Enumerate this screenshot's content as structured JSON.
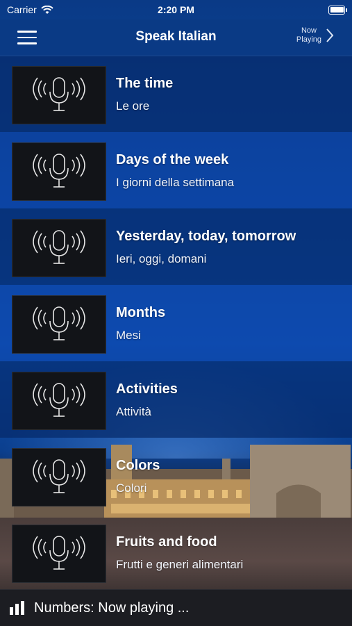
{
  "status_bar": {
    "carrier": "Carrier",
    "time": "2:20 PM"
  },
  "nav": {
    "title": "Speak Italian",
    "now_playing_line1": "Now",
    "now_playing_line2": "Playing"
  },
  "lessons": [
    {
      "title": "The time",
      "subtitle": "Le ore"
    },
    {
      "title": "Days of the week",
      "subtitle": "I giorni della settimana"
    },
    {
      "title": "Yesterday, today, tomorrow",
      "subtitle": "Ieri, oggi, domani"
    },
    {
      "title": "Months",
      "subtitle": "Mesi"
    },
    {
      "title": "Activities",
      "subtitle": "Attività"
    },
    {
      "title": "Colors",
      "subtitle": "Colori"
    },
    {
      "title": "Fruits and food",
      "subtitle": "Frutti e generi alimentari"
    }
  ],
  "player": {
    "text": "Numbers: Now playing ..."
  },
  "icons": {
    "menu": "hamburger-menu-icon",
    "now_playing": "chevron-right-icon",
    "lesson_thumb": "microphone-icon",
    "player": "audio-bars-icon",
    "wifi": "wifi-icon",
    "battery": "battery-icon"
  },
  "colors": {
    "nav_background": "#0a3a85",
    "player_background": "#1c1d22"
  }
}
